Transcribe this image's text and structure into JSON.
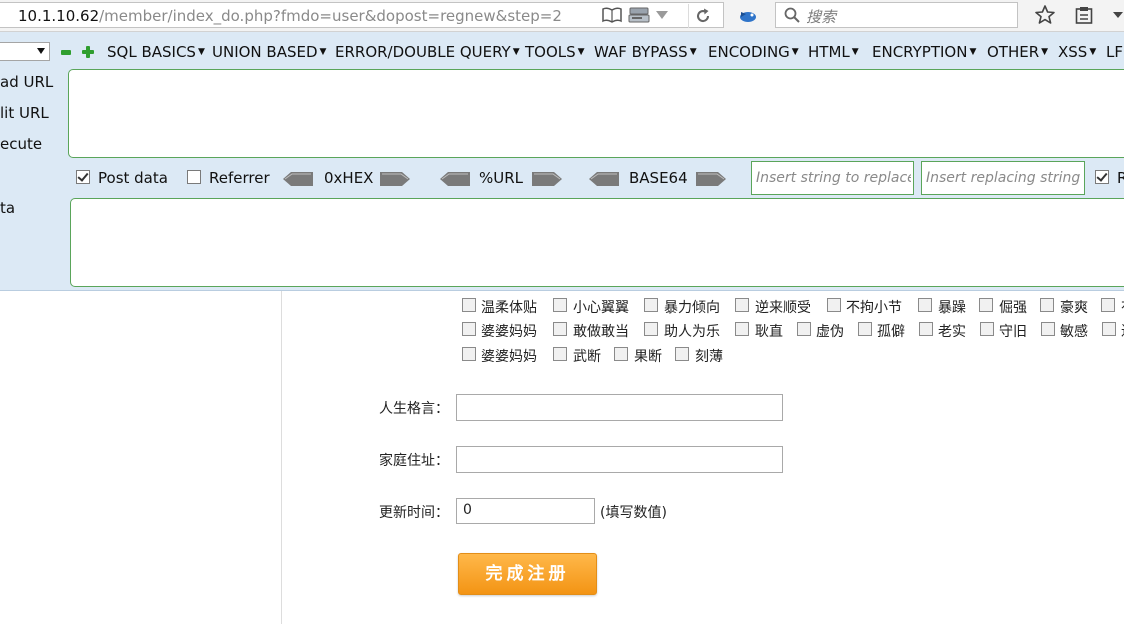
{
  "address_bar": {
    "url_host": "10.1.10.62",
    "url_path": "/member/index_do.php?fmdo=user&dopost=regnew&step=2",
    "search_placeholder": "搜索",
    "icons": [
      "reader-icon",
      "save-icon",
      "dropdown-icon",
      "reload-icon",
      "extension-icon",
      "search-icon",
      "bookmark-star-icon",
      "bookmarks-list-icon",
      "chevron-down-icon"
    ]
  },
  "hackbar": {
    "menus": [
      {
        "label": "SQL BASICS"
      },
      {
        "label": "UNION BASED"
      },
      {
        "label": "ERROR/DOUBLE QUERY"
      },
      {
        "label": "TOOLS"
      },
      {
        "label": "WAF BYPASS"
      },
      {
        "label": "ENCODING"
      },
      {
        "label": "HTML"
      },
      {
        "label": "ENCRYPTION"
      },
      {
        "label": "OTHER"
      },
      {
        "label": "XSS"
      },
      {
        "label": "LFI"
      }
    ],
    "side": {
      "load_url": "ad URL",
      "split_url": "lit URL",
      "execute": "ecute",
      "post_data": "ta"
    },
    "post_data_label": "Post data",
    "post_data_checked": true,
    "referrer_label": "Referrer",
    "referrer_checked": false,
    "hex_label": "0xHEX",
    "url_label": "%URL",
    "base64_label": "BASE64",
    "replace_placeholder": "Insert string to replace",
    "replacing_placeholder": "Insert replacing string",
    "last_check_label": "R",
    "last_check_checked": true,
    "url_value": "",
    "post_value": "",
    "colors": {
      "background": "#dce9f5",
      "border": "#5aa55a"
    }
  },
  "form": {
    "trait_rows": [
      [
        "温柔体贴",
        "小心翼翼",
        "暴力倾向",
        "逆来顺受",
        "不拘小节",
        "暴躁",
        "倔强",
        "豪爽",
        "有"
      ],
      [
        "婆婆妈妈",
        "敢做敢当",
        "助人为乐",
        "耿直",
        "虚伪",
        "孤僻",
        "老实",
        "守旧",
        "敏感",
        "迟"
      ],
      [
        "婆婆妈妈",
        "武断",
        "果断",
        "刻薄"
      ]
    ],
    "motto_label": "人生格言：",
    "motto_value": "",
    "address_label": "家庭住址：",
    "address_value": "",
    "update_time_label": "更新时间：",
    "update_time_value": "0",
    "update_time_hint": "(填写数值)",
    "submit_label": "完成注册",
    "colors": {
      "submit": "#f39414"
    }
  }
}
